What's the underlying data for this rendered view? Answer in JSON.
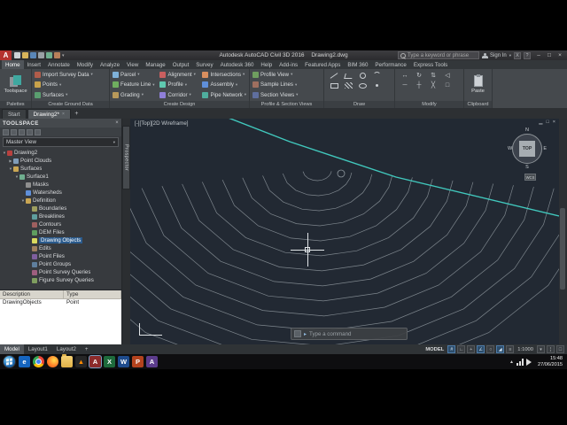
{
  "colors": {
    "canvas_bg": "#222933",
    "contour": "#8e979e",
    "boundary_teal": "#41c8bd",
    "selection_blue": "#2a5a8c"
  },
  "titlebar": {
    "logo": "A",
    "app_title": "Autodesk AutoCAD Civil 3D 2016",
    "doc_title": "Drawing2.dwg",
    "search_placeholder": "Type a keyword or phrase",
    "signin": "Sign In",
    "minimize": "–",
    "maximize": "□",
    "close": "×"
  },
  "ribbon": {
    "tabs": [
      {
        "label": "Home",
        "cls": "active"
      },
      {
        "label": "Insert"
      },
      {
        "label": "Annotate"
      },
      {
        "label": "Modify"
      },
      {
        "label": "Analyze"
      },
      {
        "label": "View"
      },
      {
        "label": "Manage"
      },
      {
        "label": "Output"
      },
      {
        "label": "Survey"
      },
      {
        "label": "Autodesk 360"
      },
      {
        "label": "Help"
      },
      {
        "label": "Add-ins"
      },
      {
        "label": "Featured Apps"
      },
      {
        "label": "BIM 360"
      },
      {
        "label": "Performance"
      },
      {
        "label": "Express Tools"
      }
    ],
    "panel_labels": [
      "Palettes",
      "Create Ground Data",
      "Create Design",
      "Profile & Section Views",
      "Draw",
      "Modify",
      "Clipboard"
    ],
    "palettes_button": "Toolspace",
    "paste_label": "Paste",
    "create_ground": [
      {
        "label": "Import Survey Data",
        "ic": "#b05c4a"
      },
      {
        "label": "Points",
        "ic": "#c8a24a"
      },
      {
        "label": "Surfaces",
        "ic": "#5a9e6f"
      }
    ],
    "design_col1": [
      {
        "label": "Parcel",
        "ic": "#7fb2d9"
      },
      {
        "label": "Feature Line",
        "ic": "#6fae5f"
      },
      {
        "label": "Grading",
        "ic": "#b8995a"
      }
    ],
    "design_col2": [
      {
        "label": "Alignment",
        "ic": "#c95f5f"
      },
      {
        "label": "Profile",
        "ic": "#5fc9b0"
      },
      {
        "label": "Corridor",
        "ic": "#8f7fd9"
      }
    ],
    "design_col3": [
      {
        "label": "Intersections",
        "ic": "#d98f5f"
      },
      {
        "label": "Assembly",
        "ic": "#5f8fd9"
      },
      {
        "label": "Pipe Network",
        "ic": "#4fae9e"
      }
    ],
    "psv": [
      {
        "label": "Profile View",
        "ic": "#6f9e5f"
      },
      {
        "label": "Sample Lines",
        "ic": "#9e6f5f"
      },
      {
        "label": "Section Views",
        "ic": "#5f6f9e"
      }
    ],
    "modify_icons": [
      {
        "g": "↔"
      },
      {
        "g": "↻"
      },
      {
        "g": "⇅"
      },
      {
        "g": "◁"
      },
      {
        "g": "─"
      },
      {
        "g": "┼"
      },
      {
        "g": "╳"
      },
      {
        "g": "□"
      }
    ]
  },
  "file_tabs": {
    "start": "Start",
    "drawing": "Drawing2*",
    "close_glyph": "×",
    "new_glyph": "+"
  },
  "toolspace": {
    "title": "TOOLSPACE",
    "close_glyph": "×",
    "view_selector": "Master View",
    "side_tab": "Prospector",
    "tree": [
      {
        "label": "Drawing2",
        "level": 0,
        "exp": "▼",
        "ic": "#b8413f"
      },
      {
        "label": "Point Clouds",
        "level": 1,
        "exp": "▶",
        "ic": "#7f9cb8"
      },
      {
        "label": "Surfaces",
        "level": 1,
        "exp": "▼",
        "ic": "#c9a653"
      },
      {
        "label": "Surface1",
        "level": 2,
        "exp": "▼",
        "ic": "#6fae8f"
      },
      {
        "label": "Masks",
        "level": 3,
        "exp": "",
        "ic": "#8f8f8f"
      },
      {
        "label": "Watersheds",
        "level": 3,
        "exp": "",
        "ic": "#5f8fd9"
      },
      {
        "label": "Definition",
        "level": 3,
        "exp": "▼",
        "ic": "#c9a653"
      },
      {
        "label": "Boundaries",
        "level": 4,
        "exp": "",
        "ic": "#9e9e5f"
      },
      {
        "label": "Breaklines",
        "level": 4,
        "exp": "",
        "ic": "#5f9e9e"
      },
      {
        "label": "Contours",
        "level": 4,
        "exp": "",
        "ic": "#9e5f5f"
      },
      {
        "label": "DEM Files",
        "level": 4,
        "exp": "",
        "ic": "#5f9e5f"
      },
      {
        "label": "Drawing Objects",
        "level": 4,
        "exp": "",
        "ic": "#d9d95f",
        "cls": "sel"
      },
      {
        "label": "Edits",
        "level": 4,
        "exp": "",
        "ic": "#9e7f5f"
      },
      {
        "label": "Point Files",
        "level": 4,
        "exp": "",
        "ic": "#7f5f9e"
      },
      {
        "label": "Point Groups",
        "level": 4,
        "exp": "",
        "ic": "#5f7f9e"
      },
      {
        "label": "Point Survey Queries",
        "level": 4,
        "exp": "",
        "ic": "#9e5f7f"
      },
      {
        "label": "Figure Survey Queries",
        "level": 4,
        "exp": "",
        "ic": "#7f9e5f"
      }
    ],
    "grid": {
      "columns": [
        "Description",
        "Type"
      ],
      "rows": [
        [
          "DrawingObjects",
          "Point"
        ]
      ]
    }
  },
  "canvas": {
    "viewport_controls": "[-][Top][2D Wireframe]",
    "command_prompt": "▸",
    "command_placeholder": "Type a command",
    "viewcube": {
      "n": "N",
      "s": "S",
      "e": "E",
      "w": "W",
      "face": "TOP"
    },
    "wcs": "WCS",
    "win_min": "▁",
    "win_restore": "□",
    "win_close": "×"
  },
  "statusbar": {
    "layout_tabs": [
      {
        "label": "Model",
        "cls": "active"
      },
      {
        "label": "Layout1"
      },
      {
        "label": "Layout2"
      },
      {
        "label": "+"
      }
    ],
    "model_label": "MODEL",
    "icons1": [
      {
        "g": "#",
        "cls": "on"
      },
      {
        "g": "∟"
      },
      {
        "g": "+"
      },
      {
        "g": "∠",
        "cls": "on"
      },
      {
        "g": "○"
      },
      {
        "g": "◢",
        "cls": "on"
      },
      {
        "g": "≡"
      }
    ],
    "scale": "1:1000",
    "icons2": [
      {
        "g": "▾"
      },
      {
        "g": "¦"
      },
      {
        "g": "□"
      }
    ]
  },
  "taskbar": {
    "icons": [
      {
        "glyph": "e",
        "bg": "#1565c0"
      },
      {
        "glyph": "",
        "cls": "chrome"
      },
      {
        "glyph": "",
        "cls": "firefox"
      },
      {
        "glyph": "",
        "cls": "folder"
      },
      {
        "glyph": "▲",
        "bg": "#262626",
        "color": "#ff8c00"
      },
      {
        "glyph": "A",
        "bg": "#8c2b2b",
        "cls": "active"
      },
      {
        "glyph": "X",
        "bg": "#1e6b3c"
      },
      {
        "glyph": "W",
        "bg": "#1e4b8c"
      },
      {
        "glyph": "P",
        "bg": "#b4431e"
      },
      {
        "glyph": "A",
        "bg": "#5c3c8c"
      }
    ],
    "clock_time": "15:48",
    "clock_date": "27/06/2015"
  }
}
